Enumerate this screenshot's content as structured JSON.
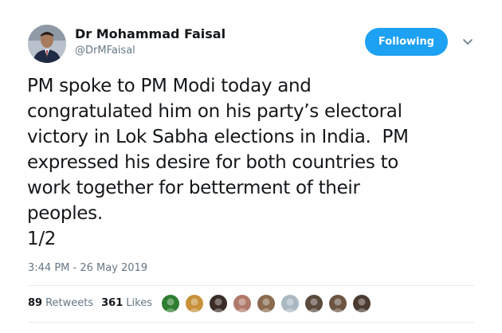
{
  "author": {
    "name": "Dr Mohammad Faisal",
    "handle": "@DrMFaisal"
  },
  "follow_button": {
    "label": "Following"
  },
  "tweet": {
    "lines": [
      "PM spoke to PM Modi today and",
      "congratulated him on his party’s electoral",
      "victory in Lok Sabha elections in India.  PM",
      "expressed his desire for both countries to",
      "work together for betterment of their",
      "peoples.",
      "1/2"
    ],
    "timestamp": "3:44 PM - 26 May 2019"
  },
  "stats": {
    "retweets_count": "89",
    "retweets_label": "Retweets",
    "likes_count": "361",
    "likes_label": "Likes"
  },
  "likers": [
    {
      "name": "liker-avatar-1",
      "color": "#2e7d32"
    },
    {
      "name": "liker-avatar-2",
      "color": "#c8913a"
    },
    {
      "name": "liker-avatar-3",
      "color": "#3a2b27"
    },
    {
      "name": "liker-avatar-4",
      "color": "#b07a6a"
    },
    {
      "name": "liker-avatar-5",
      "color": "#8a6a4e"
    },
    {
      "name": "liker-avatar-6",
      "color": "#aab8c2"
    },
    {
      "name": "liker-avatar-7",
      "color": "#5a4a3c"
    },
    {
      "name": "liker-avatar-8",
      "color": "#6b5442"
    },
    {
      "name": "liker-avatar-9",
      "color": "#4a3b30"
    }
  ],
  "colors": {
    "accent": "#1da1f2",
    "text": "#14171a",
    "muted": "#657786",
    "divider": "#e6ecf0"
  }
}
